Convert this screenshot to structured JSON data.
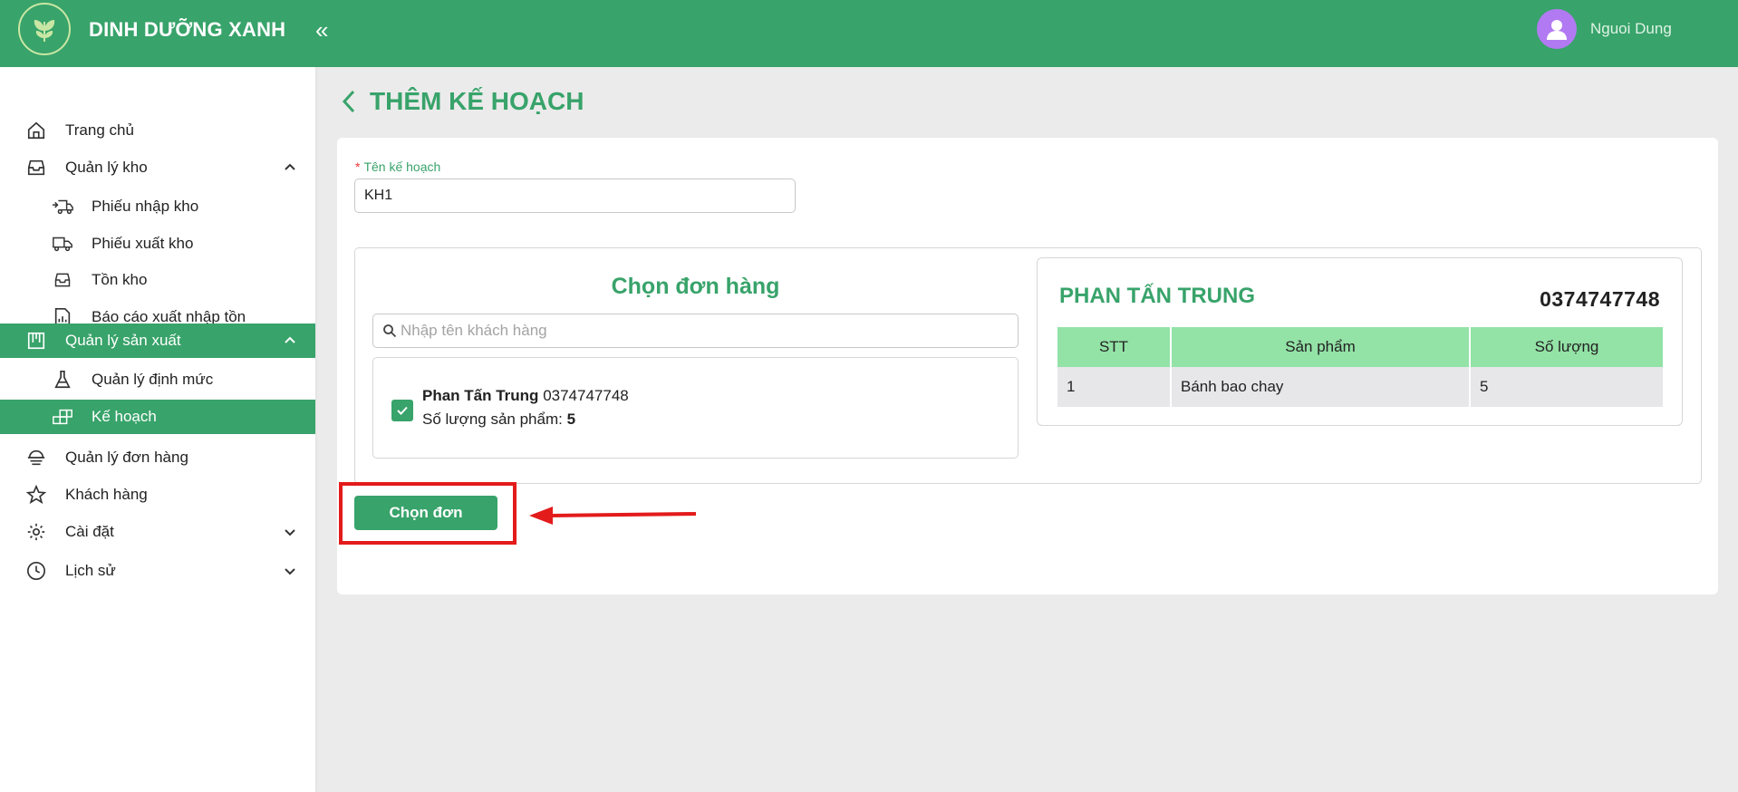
{
  "app": {
    "title": "DINH DƯỠNG XANH"
  },
  "header": {
    "collapse_icon": "«",
    "user_name": "Nguoi Dung"
  },
  "sidebar": {
    "items": [
      {
        "label": "Trang chủ",
        "icon": "home-icon"
      },
      {
        "label": "Quản lý kho",
        "icon": "inbox-icon",
        "expanded": true
      },
      {
        "label": "Phiếu nhập kho",
        "icon": "truck-in-icon"
      },
      {
        "label": "Phiếu xuất kho",
        "icon": "truck-out-icon"
      },
      {
        "label": "Tồn kho",
        "icon": "inventory-icon"
      },
      {
        "label": "Báo cáo xuất nhập tồn",
        "icon": "report-icon"
      },
      {
        "label": "Quản lý sản xuất",
        "icon": "factory-icon",
        "expanded": true,
        "active": true
      },
      {
        "label": "Quản lý định mức",
        "icon": "flask-icon"
      },
      {
        "label": "Kế hoạch",
        "icon": "blocks-icon",
        "active": true
      },
      {
        "label": "Quản lý đơn hàng",
        "icon": "order-icon"
      },
      {
        "label": "Khách hàng",
        "icon": "star-icon"
      },
      {
        "label": "Cài đặt",
        "icon": "gear-icon",
        "expanded": false
      },
      {
        "label": "Lịch sử",
        "icon": "clock-icon",
        "expanded": false
      }
    ]
  },
  "main": {
    "title": "THÊM KẾ HOẠCH",
    "plan_name": {
      "label": "Tên kế hoạch",
      "required_mark": "*",
      "value": "KH1"
    },
    "order_picker": {
      "title": "Chọn đơn hàng",
      "search_placeholder": "Nhập tên khách hàng",
      "orders": [
        {
          "name": "Phan Tấn Trung",
          "phone": "0374747748",
          "qty_label": "Số lượng sản phẩm:",
          "qty": "5",
          "checked": true
        }
      ]
    },
    "detail": {
      "customer_name": "PHAN TẤN TRUNG",
      "phone": "0374747748",
      "columns": [
        "STT",
        "Sản phẩm",
        "Số lượng"
      ],
      "rows": [
        [
          "1",
          "Bánh bao chay",
          "5"
        ]
      ]
    },
    "select_button": "Chọn đơn"
  },
  "colors": {
    "primary": "#38a36a",
    "table_header": "#93e2a6",
    "annotation": "#e31b1b"
  }
}
